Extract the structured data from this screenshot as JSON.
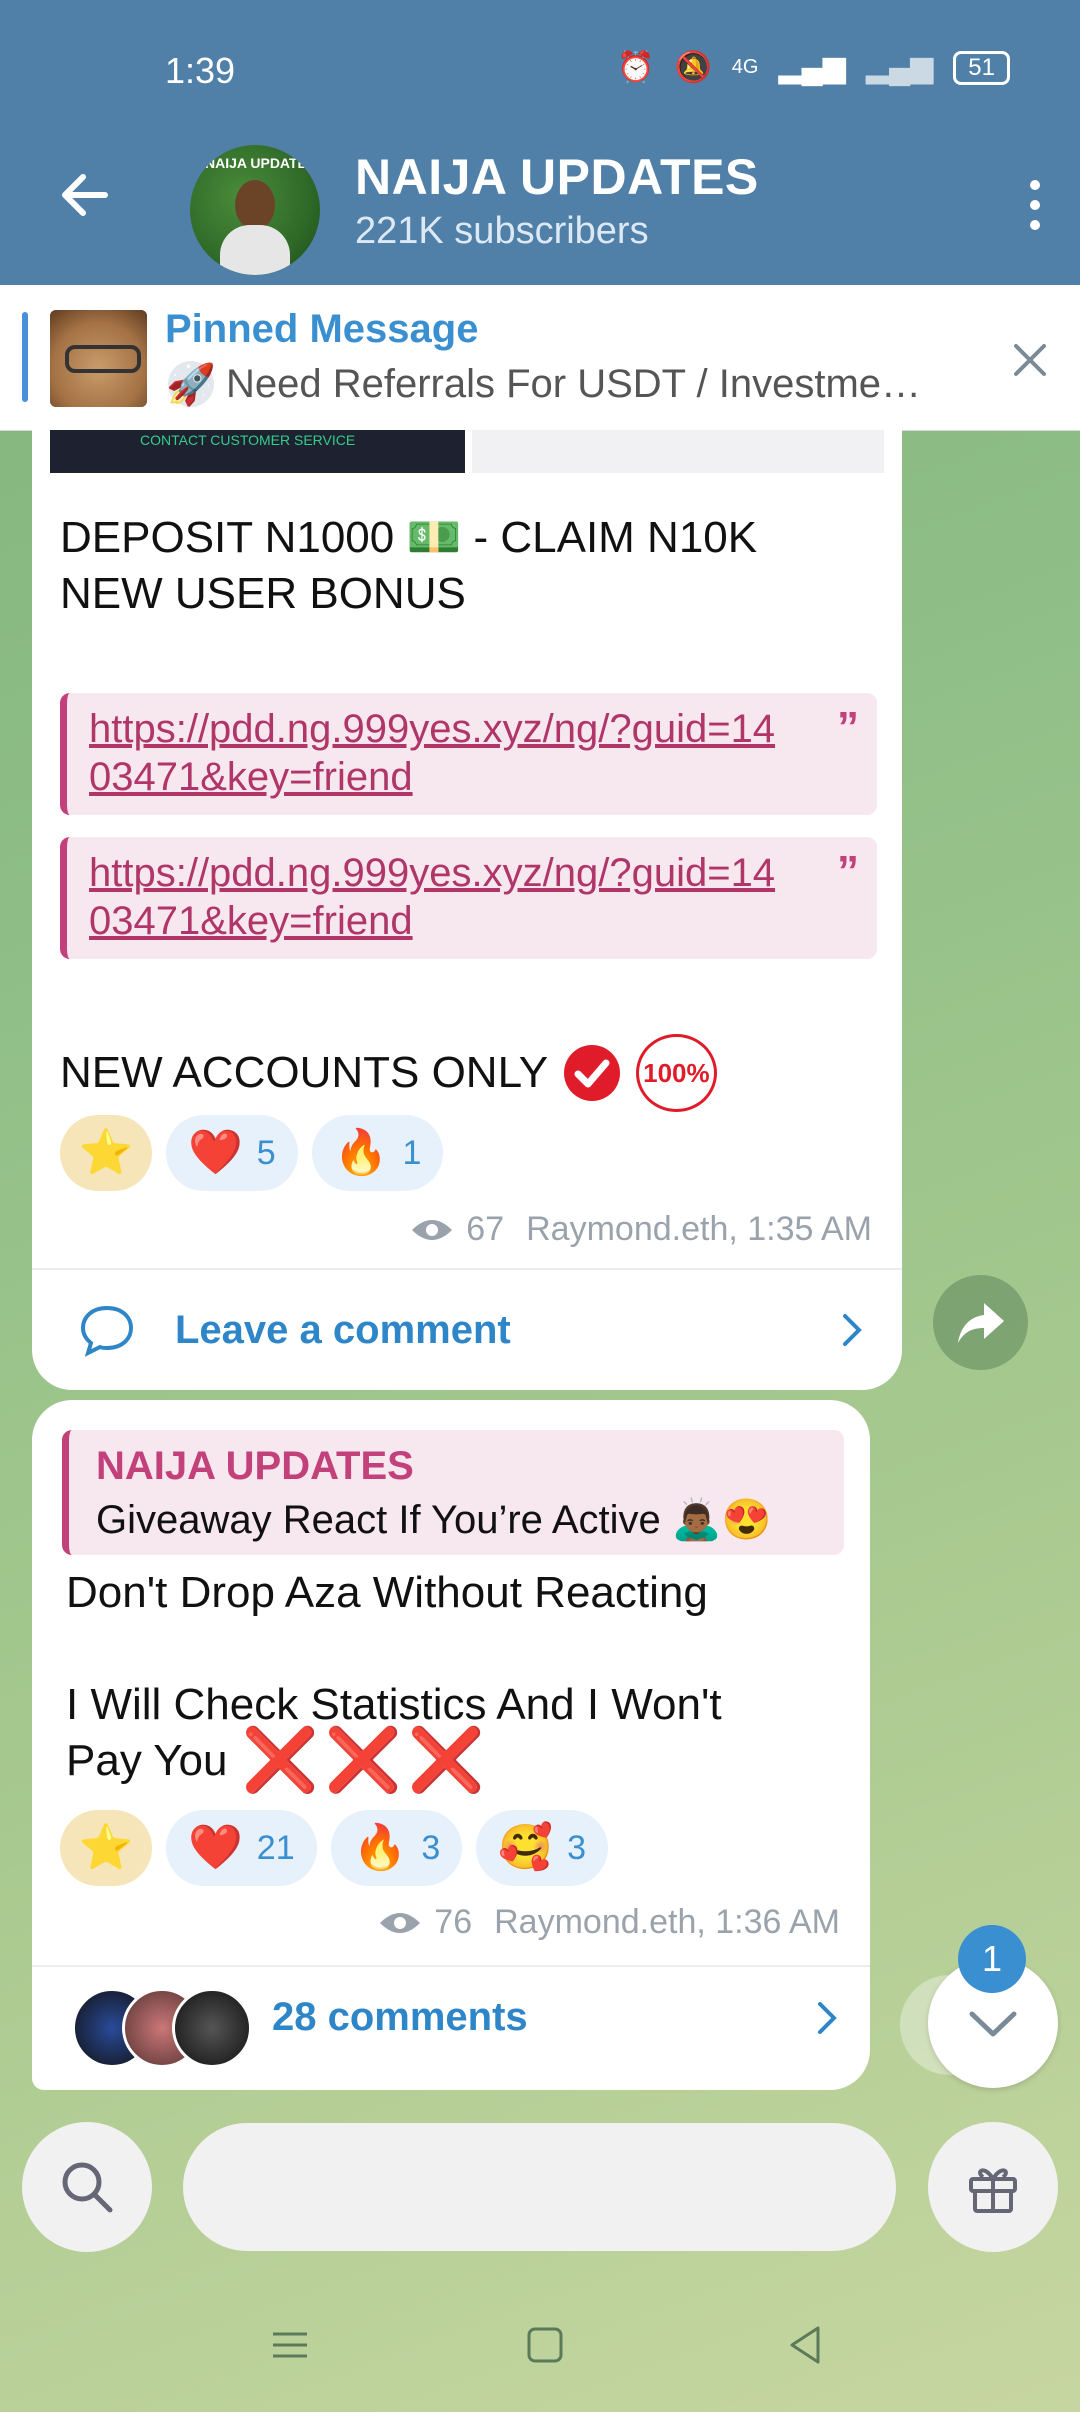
{
  "status_bar": {
    "time": "1:39",
    "network": "4G",
    "battery": "51"
  },
  "header": {
    "title": "NAIJA UPDATES",
    "subtitle": "221K subscribers",
    "avatar_text": "NAIJA UPDATES"
  },
  "pinned": {
    "title": "Pinned Message",
    "preview": "Need Referrals For USDT / Investme…"
  },
  "post1": {
    "image_caption": "CONTACT CUSTOMER SERVICE",
    "line1": "DEPOSIT N1000 💵 - CLAIM N10K",
    "line2": "NEW USER BONUS",
    "links": [
      "https://pdd.ng.999yes.xyz/ng/?guid=1403471&key=friend",
      "https://pdd.ng.999yes.xyz/ng/?guid=1403471&key=friend"
    ],
    "footer_text": "NEW ACCOUNTS ONLY",
    "badge_text": "100%",
    "reactions": [
      {
        "emoji": "⭐",
        "count": ""
      },
      {
        "emoji": "❤️",
        "count": "5"
      },
      {
        "emoji": "🔥",
        "count": "1"
      }
    ],
    "views": "67",
    "author_time": "Raymond.eth, 1:35 AM",
    "comment_label": "Leave a comment"
  },
  "post2": {
    "reply_name": "NAIJA UPDATES",
    "reply_text": "Giveaway   React If You’re Active 🙇🏾‍♂️😍",
    "line1": "Don't Drop Aza Without Reacting",
    "line2": "I Will Check Statistics And I Won't",
    "line3": "Pay You",
    "x_marks": "❌❌❌",
    "reactions": [
      {
        "emoji": "⭐",
        "count": ""
      },
      {
        "emoji": "❤️",
        "count": "21"
      },
      {
        "emoji": "🔥",
        "count": "3"
      },
      {
        "emoji": "🥰",
        "count": "3"
      }
    ],
    "views": "76",
    "author_time": "Raymond.eth, 1:36 AM",
    "comments_label": "28 comments"
  },
  "unread_count": "1",
  "colors": {
    "header": "#5080a8",
    "accent_blue": "#3a8fd0",
    "quote_pink": "#c2417b"
  },
  "icons": {
    "back": "arrow-left-icon",
    "more": "more-vertical-icon",
    "close": "close-icon",
    "eye": "eye-icon",
    "comment": "comment-bubble-icon",
    "chevron": "chevron-right-icon",
    "forward": "share-icon",
    "scroll": "chevron-down-icon",
    "search": "search-icon",
    "gift": "gift-icon"
  }
}
